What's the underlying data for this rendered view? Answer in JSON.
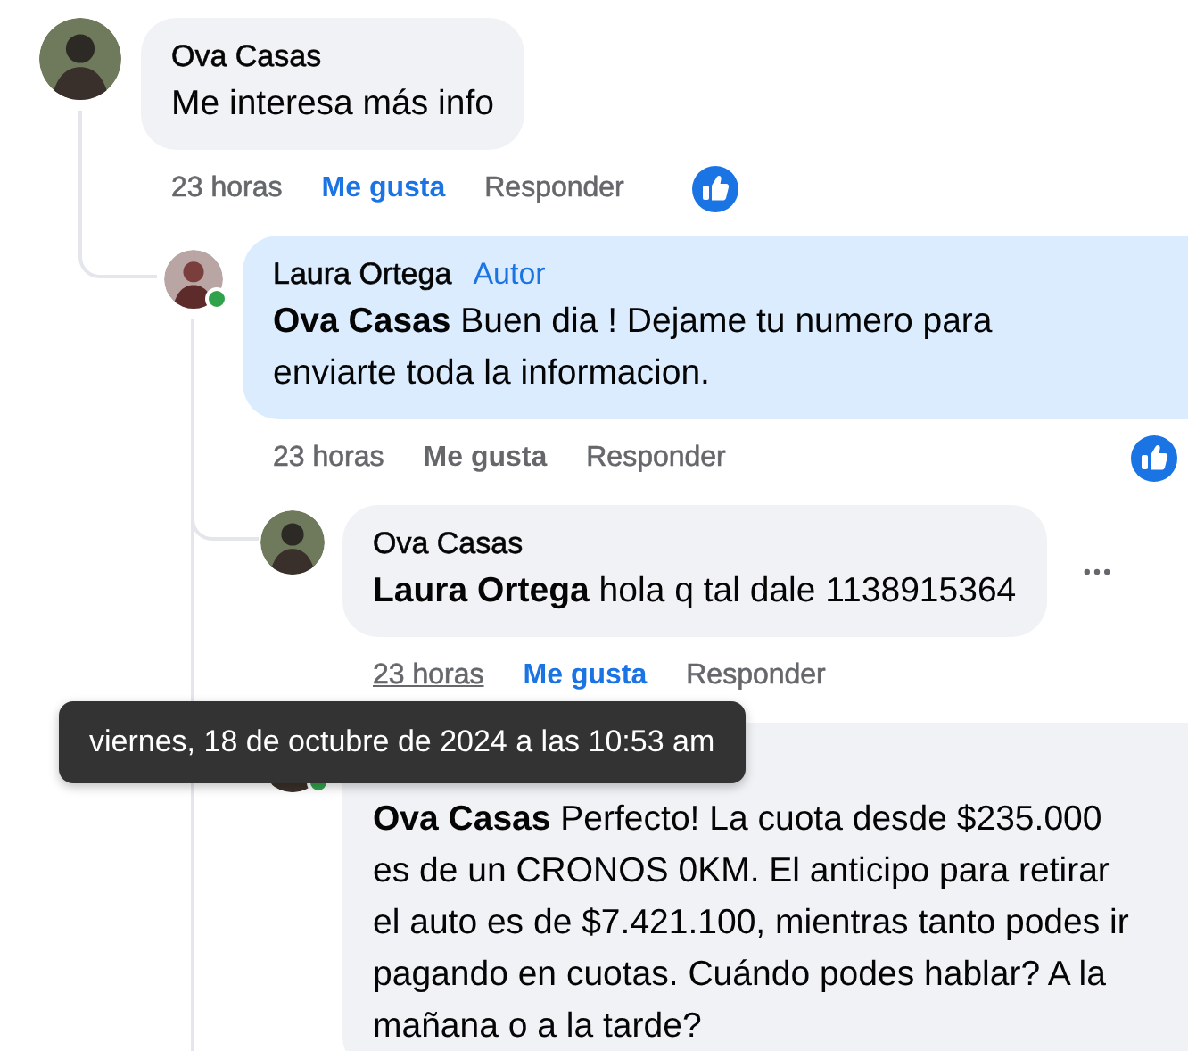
{
  "comments": [
    {
      "author": "Ova Casas",
      "text": "Me interesa más info",
      "time": "23 horas",
      "like": "Me gusta",
      "liked": true,
      "reply": "Responder",
      "reacted": true,
      "children": [
        {
          "author": "Laura Ortega",
          "badge": "Autor",
          "text": "**Ova Casas** Buen dia ! Dejame tu numero para enviarte toda la informacion.",
          "time": "23 horas",
          "like": "Me gusta",
          "liked": false,
          "reply": "Responder",
          "reacted": true,
          "online": true,
          "highlighted": true,
          "children": [
            {
              "author": "Ova Casas",
              "text": "**Laura Ortega** hola q tal dale 1138915364",
              "time": "23 horas",
              "like": "Me gusta",
              "liked": true,
              "reply": "Responder",
              "hovered": true
            },
            {
              "text": "**Ova Casas** Perfecto! La cuota desde $235.000 es de un CRONOS 0KM. El anticipo para retirar el auto es de $7.421.100, mientras tanto podes ir pagando en cuotas. Cuándo podes hablar? A la mañana o a la tarde?",
              "online": true
            }
          ]
        }
      ]
    }
  ],
  "tooltip": "viernes, 18 de octubre de 2024 a las 10:53 am"
}
